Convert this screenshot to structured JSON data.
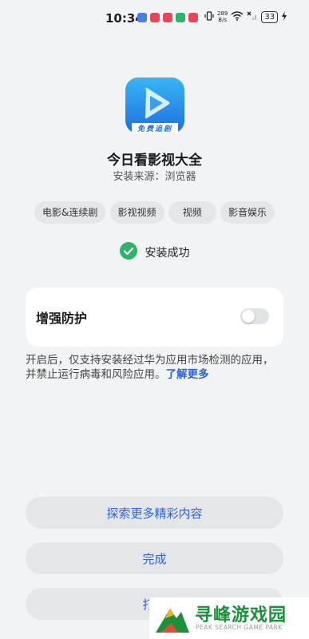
{
  "status_bar": {
    "time": "10:34",
    "net_speed": "289\nB/s",
    "battery": "33"
  },
  "app": {
    "icon_label": "免费追剧",
    "name": "今日看影视大全",
    "source": "安装来源：浏览器",
    "tags": [
      "电影&连续剧",
      "影视视频",
      "视频",
      "影音娱乐"
    ]
  },
  "status": {
    "text": "安装成功"
  },
  "protection": {
    "label": "增强防护",
    "enabled": false,
    "description": "开启后，仅支持安装经过华为应用市场检测的应用，并禁止运行病毒和风险应用。",
    "link": "了解更多"
  },
  "buttons": {
    "explore": "探索更多精彩内容",
    "done": "完成",
    "open": "打开"
  },
  "watermark": {
    "title": "寻峰游戏园",
    "subtitle": "PEAK SEARCH GAME PARK"
  },
  "colors": {
    "accent": "#2f62d6",
    "success": "#2fb36b",
    "background": "#f1f3f5"
  }
}
